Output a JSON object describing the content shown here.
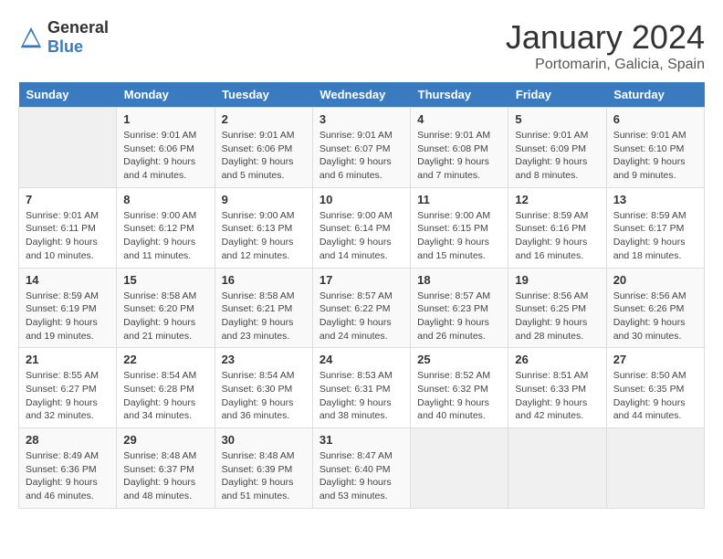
{
  "header": {
    "logo_general": "General",
    "logo_blue": "Blue",
    "month": "January 2024",
    "location": "Portomarin, Galicia, Spain"
  },
  "columns": [
    "Sunday",
    "Monday",
    "Tuesday",
    "Wednesday",
    "Thursday",
    "Friday",
    "Saturday"
  ],
  "weeks": [
    [
      {
        "day": "",
        "text": ""
      },
      {
        "day": "1",
        "text": "Sunrise: 9:01 AM\nSunset: 6:06 PM\nDaylight: 9 hours\nand 4 minutes."
      },
      {
        "day": "2",
        "text": "Sunrise: 9:01 AM\nSunset: 6:06 PM\nDaylight: 9 hours\nand 5 minutes."
      },
      {
        "day": "3",
        "text": "Sunrise: 9:01 AM\nSunset: 6:07 PM\nDaylight: 9 hours\nand 6 minutes."
      },
      {
        "day": "4",
        "text": "Sunrise: 9:01 AM\nSunset: 6:08 PM\nDaylight: 9 hours\nand 7 minutes."
      },
      {
        "day": "5",
        "text": "Sunrise: 9:01 AM\nSunset: 6:09 PM\nDaylight: 9 hours\nand 8 minutes."
      },
      {
        "day": "6",
        "text": "Sunrise: 9:01 AM\nSunset: 6:10 PM\nDaylight: 9 hours\nand 9 minutes."
      }
    ],
    [
      {
        "day": "7",
        "text": "Sunrise: 9:01 AM\nSunset: 6:11 PM\nDaylight: 9 hours\nand 10 minutes."
      },
      {
        "day": "8",
        "text": "Sunrise: 9:00 AM\nSunset: 6:12 PM\nDaylight: 9 hours\nand 11 minutes."
      },
      {
        "day": "9",
        "text": "Sunrise: 9:00 AM\nSunset: 6:13 PM\nDaylight: 9 hours\nand 12 minutes."
      },
      {
        "day": "10",
        "text": "Sunrise: 9:00 AM\nSunset: 6:14 PM\nDaylight: 9 hours\nand 14 minutes."
      },
      {
        "day": "11",
        "text": "Sunrise: 9:00 AM\nSunset: 6:15 PM\nDaylight: 9 hours\nand 15 minutes."
      },
      {
        "day": "12",
        "text": "Sunrise: 8:59 AM\nSunset: 6:16 PM\nDaylight: 9 hours\nand 16 minutes."
      },
      {
        "day": "13",
        "text": "Sunrise: 8:59 AM\nSunset: 6:17 PM\nDaylight: 9 hours\nand 18 minutes."
      }
    ],
    [
      {
        "day": "14",
        "text": "Sunrise: 8:59 AM\nSunset: 6:19 PM\nDaylight: 9 hours\nand 19 minutes."
      },
      {
        "day": "15",
        "text": "Sunrise: 8:58 AM\nSunset: 6:20 PM\nDaylight: 9 hours\nand 21 minutes."
      },
      {
        "day": "16",
        "text": "Sunrise: 8:58 AM\nSunset: 6:21 PM\nDaylight: 9 hours\nand 23 minutes."
      },
      {
        "day": "17",
        "text": "Sunrise: 8:57 AM\nSunset: 6:22 PM\nDaylight: 9 hours\nand 24 minutes."
      },
      {
        "day": "18",
        "text": "Sunrise: 8:57 AM\nSunset: 6:23 PM\nDaylight: 9 hours\nand 26 minutes."
      },
      {
        "day": "19",
        "text": "Sunrise: 8:56 AM\nSunset: 6:25 PM\nDaylight: 9 hours\nand 28 minutes."
      },
      {
        "day": "20",
        "text": "Sunrise: 8:56 AM\nSunset: 6:26 PM\nDaylight: 9 hours\nand 30 minutes."
      }
    ],
    [
      {
        "day": "21",
        "text": "Sunrise: 8:55 AM\nSunset: 6:27 PM\nDaylight: 9 hours\nand 32 minutes."
      },
      {
        "day": "22",
        "text": "Sunrise: 8:54 AM\nSunset: 6:28 PM\nDaylight: 9 hours\nand 34 minutes."
      },
      {
        "day": "23",
        "text": "Sunrise: 8:54 AM\nSunset: 6:30 PM\nDaylight: 9 hours\nand 36 minutes."
      },
      {
        "day": "24",
        "text": "Sunrise: 8:53 AM\nSunset: 6:31 PM\nDaylight: 9 hours\nand 38 minutes."
      },
      {
        "day": "25",
        "text": "Sunrise: 8:52 AM\nSunset: 6:32 PM\nDaylight: 9 hours\nand 40 minutes."
      },
      {
        "day": "26",
        "text": "Sunrise: 8:51 AM\nSunset: 6:33 PM\nDaylight: 9 hours\nand 42 minutes."
      },
      {
        "day": "27",
        "text": "Sunrise: 8:50 AM\nSunset: 6:35 PM\nDaylight: 9 hours\nand 44 minutes."
      }
    ],
    [
      {
        "day": "28",
        "text": "Sunrise: 8:49 AM\nSunset: 6:36 PM\nDaylight: 9 hours\nand 46 minutes."
      },
      {
        "day": "29",
        "text": "Sunrise: 8:48 AM\nSunset: 6:37 PM\nDaylight: 9 hours\nand 48 minutes."
      },
      {
        "day": "30",
        "text": "Sunrise: 8:48 AM\nSunset: 6:39 PM\nDaylight: 9 hours\nand 51 minutes."
      },
      {
        "day": "31",
        "text": "Sunrise: 8:47 AM\nSunset: 6:40 PM\nDaylight: 9 hours\nand 53 minutes."
      },
      {
        "day": "",
        "text": ""
      },
      {
        "day": "",
        "text": ""
      },
      {
        "day": "",
        "text": ""
      }
    ]
  ]
}
